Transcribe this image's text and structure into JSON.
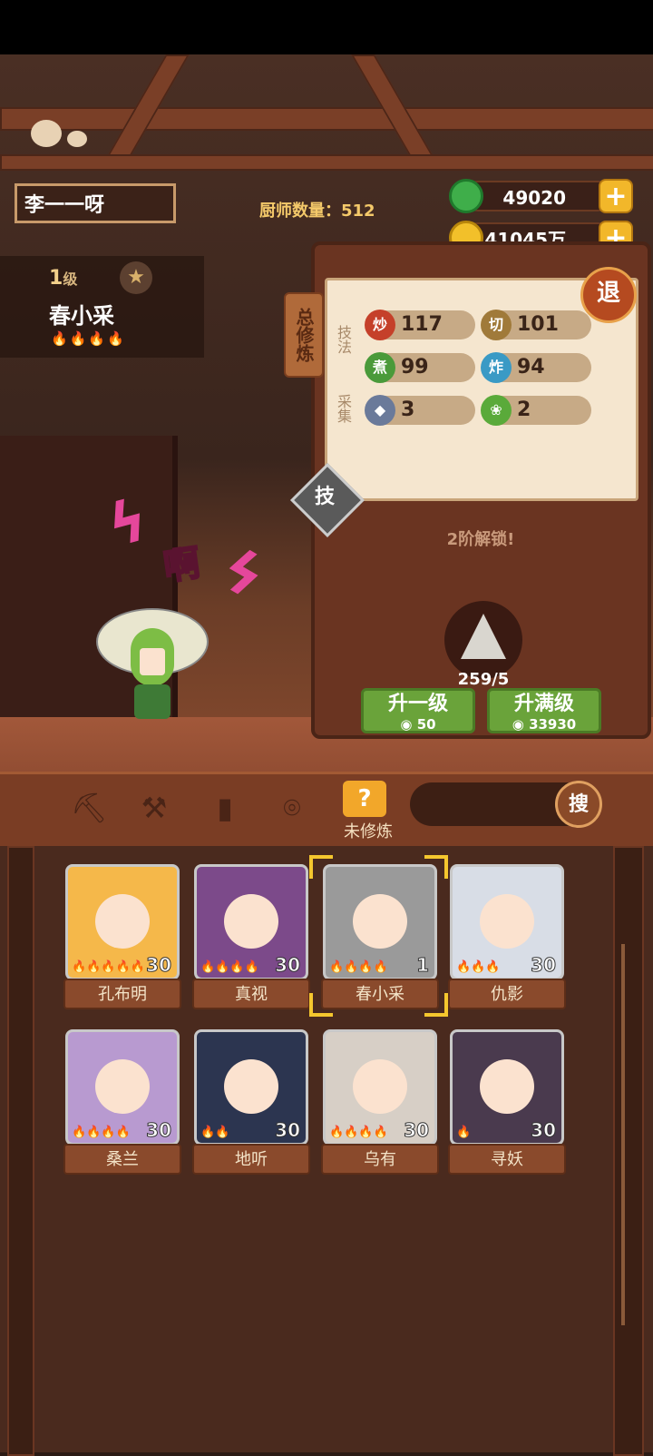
{
  "player_name": "李一一呀",
  "chef_count_label": "厨师数量：",
  "chef_count": "512",
  "currency": {
    "jade": "49020",
    "coins": "41045万",
    "colors": {
      "jade": "#3fae4a",
      "coin": "#f2c02a"
    }
  },
  "chef": {
    "level": "1",
    "level_unit": "级",
    "name": "春小采",
    "flames": "🔥🔥🔥🔥"
  },
  "board": {
    "tag": "总修炼",
    "technique_label": "技法",
    "gather_label": "采集",
    "exit": "退",
    "skill_button": "技",
    "unlock_text": "2阶解锁!",
    "stats": {
      "chao": {
        "icon": "炒",
        "value": "117"
      },
      "qie": {
        "icon": "切",
        "value": "101"
      },
      "zhu": {
        "icon": "煮",
        "value": "99"
      },
      "zha": {
        "icon": "炸",
        "value": "94"
      },
      "fish": {
        "icon": "fish-icon",
        "value": "3"
      },
      "veg": {
        "icon": "cabbage-icon",
        "value": "2"
      }
    },
    "material_count": "259/5",
    "upgrade_one": {
      "label": "升一级",
      "cost": "50"
    },
    "upgrade_max": {
      "label": "升满级",
      "cost": "33930"
    }
  },
  "character_shout": "啊",
  "tabs": {
    "active_label": "未修炼",
    "active_icon": "?",
    "search_button": "搜"
  },
  "roster": [
    {
      "name": "孔布明",
      "level": "30",
      "flames": "🔥🔥🔥🔥🔥",
      "color": "#f5b84a"
    },
    {
      "name": "真视",
      "level": "30",
      "flames": "🔥🔥🔥🔥",
      "color": "#7c4a8a"
    },
    {
      "name": "春小采",
      "level": "1",
      "flames": "🔥🔥🔥🔥",
      "color": "#9a9a9a"
    },
    {
      "name": "仇影",
      "level": "30",
      "flames": "🔥🔥🔥",
      "color": "#d8dde6"
    },
    {
      "name": "桑兰",
      "level": "30",
      "flames": "🔥🔥🔥🔥",
      "color": "#b89ad0"
    },
    {
      "name": "地听",
      "level": "30",
      "flames": "🔥🔥",
      "color": "#2c3550"
    },
    {
      "name": "乌有",
      "level": "30",
      "flames": "🔥🔥🔥🔥",
      "color": "#d7cfc6"
    },
    {
      "name": "寻妖",
      "level": "30",
      "flames": "🔥",
      "color": "#4a3a4e"
    }
  ]
}
